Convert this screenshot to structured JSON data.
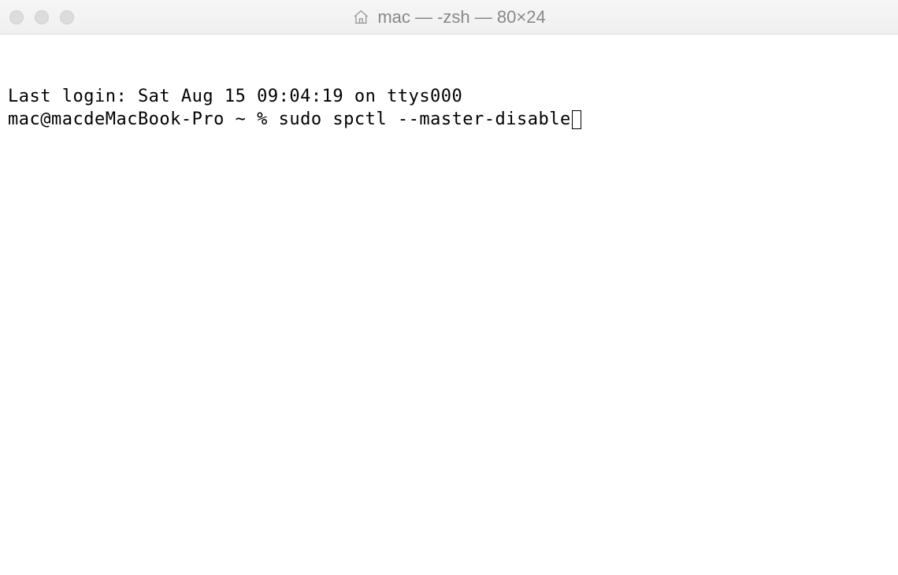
{
  "titlebar": {
    "title": "mac — -zsh — 80×24"
  },
  "terminal": {
    "last_login_line": "Last login: Sat Aug 15 09:04:19 on ttys000",
    "prompt": "mac@macdeMacBook-Pro ~ % ",
    "command": "sudo spctl --master-disable"
  }
}
